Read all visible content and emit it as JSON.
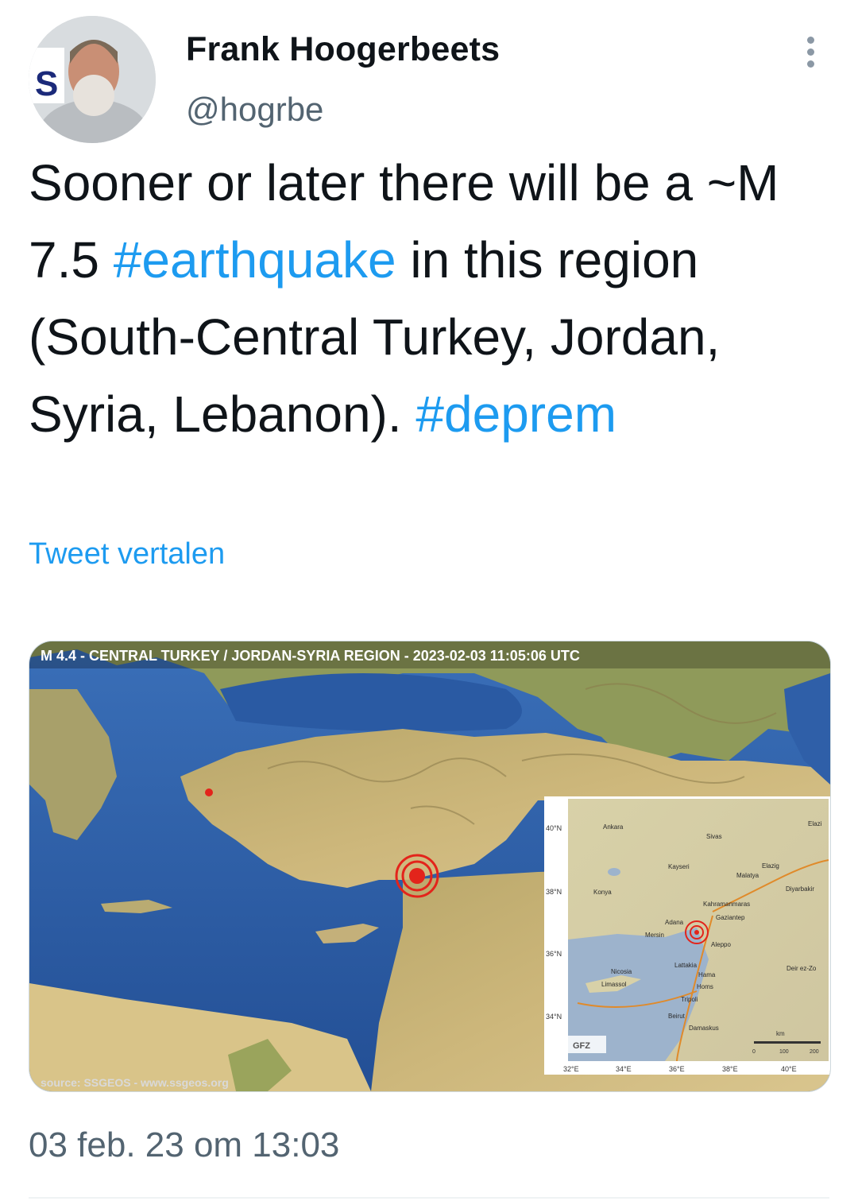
{
  "author": {
    "name": "Frank Hoogerbeets",
    "handle": "@hogrbe",
    "avatar_letter": "S"
  },
  "tweet": {
    "text_parts": [
      {
        "text": "Sooner or later there will be a ~M 7.5 ",
        "type": "plain"
      },
      {
        "text": "#earthquake",
        "type": "hashtag"
      },
      {
        "text": " in this region (South-Central Turkey, Jordan, Syria, Lebanon). ",
        "type": "plain"
      },
      {
        "text": "#deprem",
        "type": "hashtag"
      }
    ],
    "translate_label": "Tweet vertalen",
    "timestamp": "03 feb. 23 om 13:03"
  },
  "media": {
    "map_title": "M 4.4 - CENTRAL TURKEY / JORDAN-SYRIA REGION - 2023-02-03 11:05:06 UTC",
    "source_label": "source: SSGEOS - www.ssgeos.org",
    "inset": {
      "lat_labels": [
        "40°N",
        "38°N",
        "36°N",
        "34°N"
      ],
      "lon_labels": [
        "32°E",
        "34°E",
        "36°E",
        "38°E",
        "40°E"
      ],
      "cities": [
        "Ankara",
        "Sivas",
        "Kayseri",
        "Elazig",
        "Malatya",
        "Konya",
        "Diyarbakir",
        "Kahramanmaras",
        "Gaziantep",
        "Adana",
        "Mersin",
        "Aleppo",
        "Lattakia",
        "Hama",
        "Homs",
        "Nicosia",
        "Limassol",
        "Tripoli",
        "Beirut",
        "Damaskus",
        "Deir ez-Zo",
        "Elazi"
      ],
      "logo": "GFZ",
      "scale_unit": "km",
      "scale_ticks": [
        "0",
        "100",
        "200"
      ]
    }
  },
  "colors": {
    "hashtag": "#1d9bf0",
    "secondary_text": "#536471",
    "sea": "#2f5fa8",
    "land": "#c9b479",
    "epicenter": "#e3241b"
  }
}
